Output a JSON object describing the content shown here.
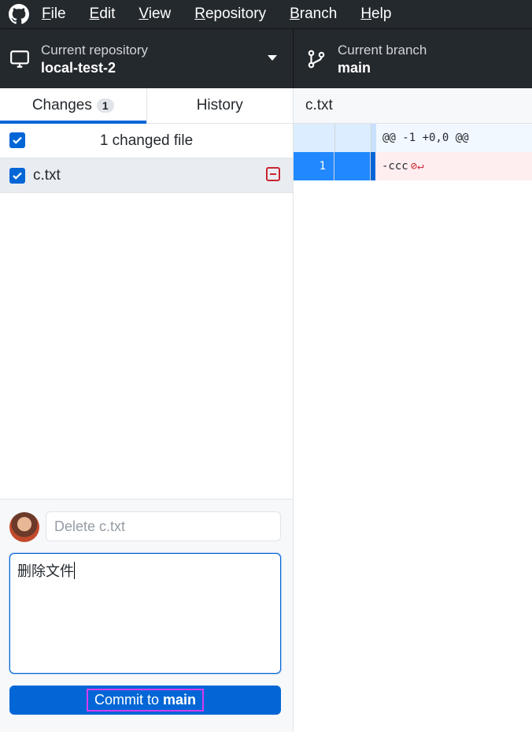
{
  "menu": {
    "items": [
      {
        "accel": "F",
        "rest": "ile"
      },
      {
        "accel": "E",
        "rest": "dit"
      },
      {
        "accel": "V",
        "rest": "iew"
      },
      {
        "accel": "R",
        "rest": "epository"
      },
      {
        "accel": "B",
        "rest": "ranch"
      },
      {
        "accel": "H",
        "rest": "elp"
      }
    ]
  },
  "toolbar": {
    "repo_label": "Current repository",
    "repo_name": "local-test-2",
    "branch_label": "Current branch",
    "branch_name": "main"
  },
  "tabs": {
    "changes_label": "Changes",
    "changes_count": "1",
    "history_label": "History"
  },
  "changes": {
    "header_label": "1 changed file",
    "files": [
      {
        "name": "c.txt",
        "status": "deleted"
      }
    ]
  },
  "commit": {
    "summary_placeholder": "Delete c.txt",
    "description": "删除文件",
    "button_prefix": "Commit to ",
    "button_branch": "main"
  },
  "diff": {
    "file_name": "c.txt",
    "hunk_header": "@@ -1 +0,0 @@",
    "lines": [
      {
        "old": "1",
        "new": "",
        "text": "-ccc"
      }
    ],
    "no_newline_glyph": "⊘↵"
  },
  "colors": {
    "accent": "#0366d6",
    "toolbar_bg": "#24292e",
    "deleted": "#cb2431",
    "focus_outline": "#d63cf0"
  }
}
